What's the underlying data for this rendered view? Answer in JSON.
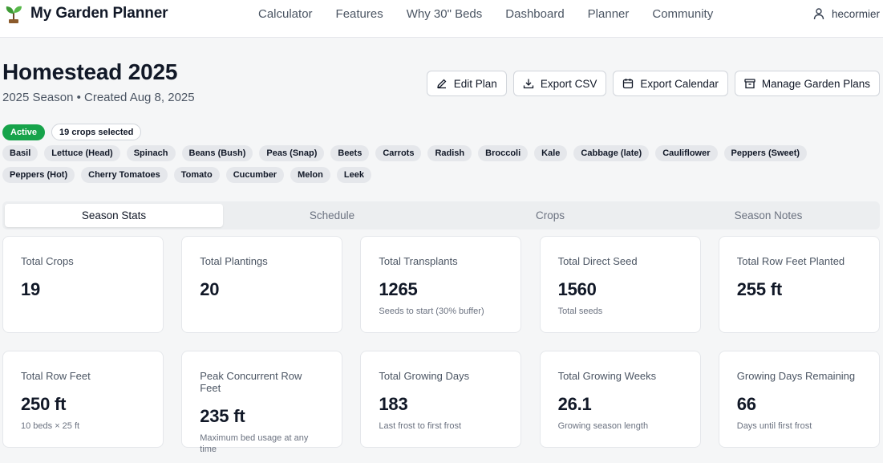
{
  "brand": {
    "name": "My Garden Planner",
    "logo_icon": "sprout-icon"
  },
  "nav": [
    "Calculator",
    "Features",
    "Why 30\" Beds",
    "Dashboard",
    "Planner",
    "Community"
  ],
  "user": {
    "name": "hecormier",
    "icon": "user-icon"
  },
  "plan": {
    "title": "Homestead 2025",
    "subtitle": "2025 Season • Created Aug 8, 2025",
    "status": "Active",
    "crop_count_label": "19 crops selected"
  },
  "actions": [
    {
      "label": "Edit Plan",
      "icon": "pencil-icon"
    },
    {
      "label": "Export CSV",
      "icon": "download-icon"
    },
    {
      "label": "Export Calendar",
      "icon": "calendar-icon"
    },
    {
      "label": "Manage Garden Plans",
      "icon": "archive-icon"
    }
  ],
  "crops": [
    "Basil",
    "Lettuce (Head)",
    "Spinach",
    "Beans (Bush)",
    "Peas (Snap)",
    "Beets",
    "Carrots",
    "Radish",
    "Broccoli",
    "Kale",
    "Cabbage (late)",
    "Cauliflower",
    "Peppers (Sweet)",
    "Peppers (Hot)",
    "Cherry Tomatoes",
    "Tomato",
    "Cucumber",
    "Melon",
    "Leek"
  ],
  "tabs": [
    "Season Stats",
    "Schedule",
    "Crops",
    "Season Notes"
  ],
  "active_tab": 0,
  "stats": [
    {
      "label": "Total Crops",
      "value": "19",
      "note": ""
    },
    {
      "label": "Total Plantings",
      "value": "20",
      "note": ""
    },
    {
      "label": "Total Transplants",
      "value": "1265",
      "note": "Seeds to start (30% buffer)"
    },
    {
      "label": "Total Direct Seed",
      "value": "1560",
      "note": "Total seeds"
    },
    {
      "label": "Total Row Feet Planted",
      "value": "255 ft",
      "note": ""
    },
    {
      "label": "Total Row Feet",
      "value": "250 ft",
      "note": "10 beds × 25 ft"
    },
    {
      "label": "Peak Concurrent Row Feet",
      "value": "235 ft",
      "note": "Maximum bed usage at any time"
    },
    {
      "label": "Total Growing Days",
      "value": "183",
      "note": "Last frost to first frost"
    },
    {
      "label": "Total Growing Weeks",
      "value": "26.1",
      "note": "Growing season length"
    },
    {
      "label": "Growing Days Remaining",
      "value": "66",
      "note": "Days until first frost"
    }
  ],
  "colors": {
    "active_badge": "#16a34a",
    "chip_bg": "#e5e7eb",
    "page_bg": "#f5f6f7",
    "sprout_green": "#3f9b36",
    "pot_brown": "#8b5a2b"
  }
}
